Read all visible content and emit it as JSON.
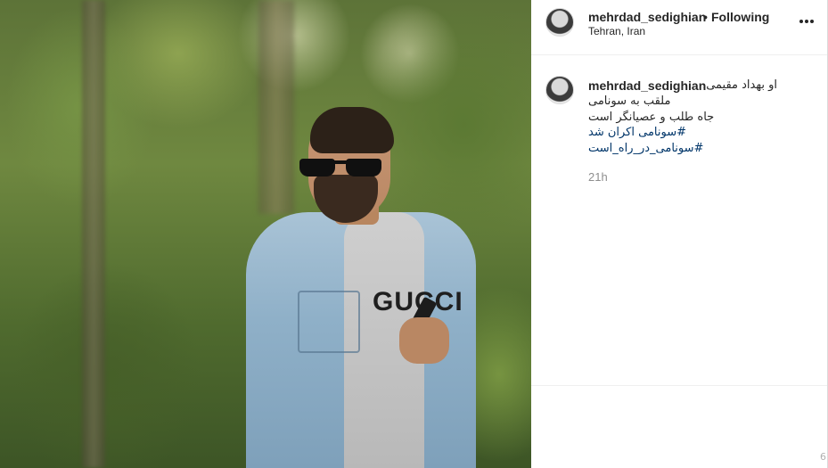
{
  "post": {
    "image_alt": "Post photo"
  },
  "header": {
    "username": "mehrdad_sedighian",
    "separator": "•",
    "follow_status": "Following",
    "location": "Tehran, Iran",
    "more_icon": "more-horizontal-icon"
  },
  "caption": {
    "username": "mehrdad_sedighian",
    "lines": [
      "او بهداد مقیمی،",
      "ملقب به سونامی",
      "جاه طلب و عصیانگر است"
    ],
    "hashtags": [
      "#سونامی اکران شد",
      "#سونامی_در_راه_است"
    ],
    "timestamp": "21h"
  },
  "image_text": {
    "hoodie_print": "GUCCI"
  },
  "corner_glyph": "6",
  "colors": {
    "hashtag": "#003569",
    "timestamp": "#8e8e8e",
    "text": "#262626"
  }
}
